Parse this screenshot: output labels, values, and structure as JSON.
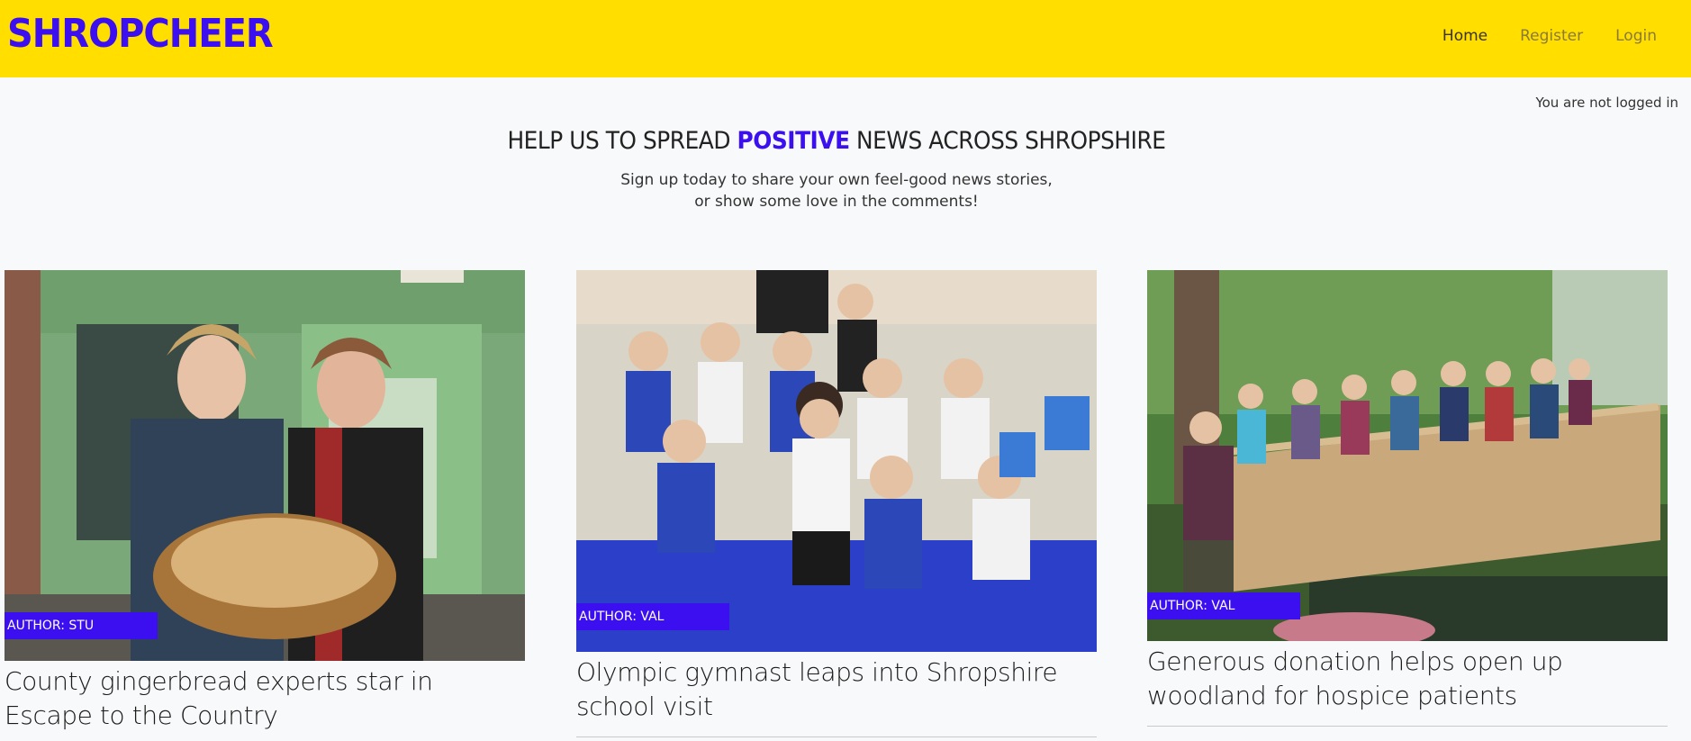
{
  "navbar": {
    "brand": "SHROPCHEER",
    "links": [
      {
        "label": "Home",
        "active": true
      },
      {
        "label": "Register",
        "active": false
      },
      {
        "label": "Login",
        "active": false
      }
    ]
  },
  "status": {
    "login_text": "You are not logged in"
  },
  "hero": {
    "title_before": "HELP US TO SPREAD ",
    "title_accent": "POSITIVE",
    "title_after": " NEWS ACROSS SHROPSHIRE",
    "subtitle_line1": "Sign up today to share your own feel-good news stories,",
    "subtitle_line2": "or show some love in the comments!"
  },
  "colors": {
    "navbar_bg": "#ffde00",
    "brand": "#3b0ff0",
    "badge_bg": "#3b0ff0",
    "page_bg": "#f8f9fa"
  },
  "posts": [
    {
      "author_label": "AUTHOR: STU",
      "title": "County gingerbread experts star in Escape to the Country",
      "image": "shopfront-bakers-photo"
    },
    {
      "author_label": "AUTHOR: VAL",
      "title": "Olympic gymnast leaps into Shropshire school visit",
      "image": "school-children-photo"
    },
    {
      "author_label": "AUTHOR: VAL",
      "title": "Generous donation helps open up woodland for hospice patients",
      "image": "woodland-bridge-photo"
    }
  ]
}
